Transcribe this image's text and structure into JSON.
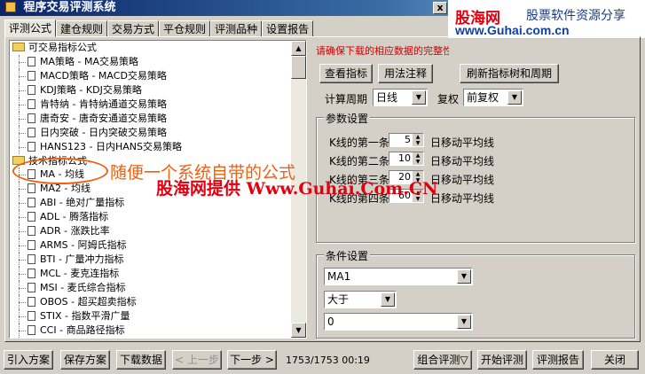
{
  "window": {
    "title": "程序交易评测系统",
    "close_label": "x"
  },
  "banner": {
    "brand": "股海网",
    "slogan": "股票软件资源分享",
    "site": "www.Guhai.com.cn"
  },
  "tabs": [
    "评测公式",
    "建仓规则",
    "交易方式",
    "平仓规则",
    "评测品种",
    "设置报告"
  ],
  "tree": {
    "groups": [
      {
        "label": "可交易指标公式",
        "items": [
          "MA策略 - MA交易策略",
          "MACD策略 - MACD交易策略",
          "KDJ策略 - KDJ交易策略",
          "肯特纳 - 肯特纳通道交易策略",
          "唐奇安 - 唐奇安通道交易策略",
          "日内突破 - 日内突破交易策略",
          "HANS123 - 日内HANS交易策略"
        ]
      },
      {
        "label": "技术指标公式",
        "items": [
          "MA - 均线",
          "MA2 - 均线",
          "ABI - 绝对广量指标",
          "ADL - 腾落指标",
          "ADR - 涨跌比率",
          "ARMS - 阿姆氏指标",
          "BTI - 广量冲力指标",
          "MCL - 麦克连指标",
          "MSI - 麦氏综合指标",
          "OBOS - 超买超卖指标",
          "STIX - 指数平滑广量",
          "CCI - 商品路径指标"
        ]
      }
    ]
  },
  "right": {
    "notice": "请确保下载的相应数据的完整性",
    "view_btn": "查看指标",
    "usage_btn": "用法注释",
    "refresh_btn": "刷新指标树和周期",
    "period_label": "计算周期",
    "period_value": "日线",
    "rights_label": "复权",
    "rights_value": "前复权",
    "params": {
      "title": "参数设置",
      "rows": [
        {
          "label": "K线的第一条",
          "value": "5",
          "suffix": "日移动平均线"
        },
        {
          "label": "K线的第二条",
          "value": "10",
          "suffix": "日移动平均线"
        },
        {
          "label": "K线的第三条",
          "value": "20",
          "suffix": "日移动平均线"
        },
        {
          "label": "K线的第四条",
          "value": "60",
          "suffix": "日移动平均线"
        }
      ]
    },
    "cond": {
      "title": "条件设置",
      "indicator": "MA1",
      "operator": "大于",
      "value": "0"
    }
  },
  "bottom": {
    "import_btn": "引入方案",
    "save_btn": "保存方案",
    "download_btn": "下载数据",
    "prev_btn": "< 上一步",
    "next_btn": "下一步 >",
    "status": "1753/1753 00:19",
    "combo_btn": "组合评测▽",
    "start_btn": "开始评测",
    "report_btn": "评测报告",
    "close_btn": "关闭"
  },
  "overlay": {
    "annotation": "随便一个系统自带的公式",
    "watermark": "股海网提供 Www.Guhai.Com.CN"
  }
}
